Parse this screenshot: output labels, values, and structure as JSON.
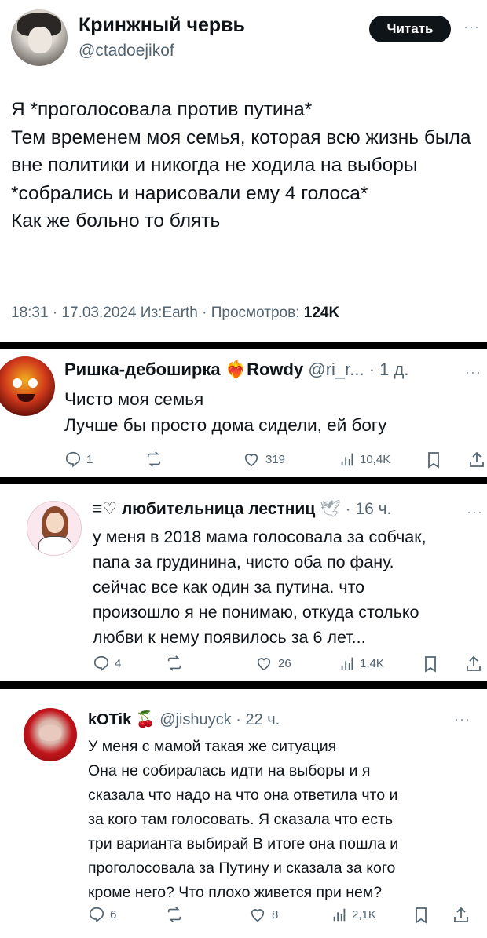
{
  "main_tweet": {
    "author_name": "Кринжный червь",
    "handle": "@ctadoejikof",
    "read_label": "Читать",
    "more": "···",
    "text": "Я *проголосовала против путина*\nТем временем моя семья, которая всю жизнь была вне политики и никогда не ходила на выборы *собрались и нарисовали ему 4 голоса*\nКак же больно то блять",
    "meta": "18:31 · 17.03.2024 Из:Earth · Просмотров: ",
    "views": "124K"
  },
  "replies": [
    {
      "name": "Ришка-дебоширка",
      "name_suffix": "Rowdy",
      "handle_time": "@ri_r... · 1 д.",
      "more": "···",
      "text": "Чисто моя семья\nЛучше бы просто дома сидели, ей богу",
      "stats": {
        "replies": "1",
        "reposts": "",
        "likes": "319",
        "views": "10,4K"
      }
    },
    {
      "name": "любительница лестниц",
      "name_prefix": "≡♡",
      "handle_time": "· 16 ч.",
      "more": "···",
      "text": "у меня в 2018 мама голосовала за собчак,\nпапа за грудинина, чисто оба по фану.\nсейчас все как один за путина. что\nпроизошло я не понимаю, откуда столько\nлюбви к нему появилось за 6 лет...",
      "stats": {
        "replies": "4",
        "reposts": "",
        "likes": "26",
        "views": "1,4K"
      }
    },
    {
      "name": "kOTik",
      "handle_time": "@jishuyck · 22 ч.",
      "more": "···",
      "text": "У меня с мамой такая же ситуация\nОна не собиралась идти на выборы и  я\nсказала что надо на что она ответила что и\nза кого там голосовать. Я сказала что есть\nтри варианта выбирай В итоге она пошла и\nпроголосовала за Путину и сказала за кого\nкроме него? Что плохо живется при нем?",
      "stats": {
        "replies": "6",
        "reposts": "",
        "likes": "8",
        "views": "2,1K"
      }
    }
  ],
  "colors": {
    "text": "#0f1419",
    "secondary": "#536471",
    "divider": "#000000",
    "button_bg": "#0f1419"
  }
}
